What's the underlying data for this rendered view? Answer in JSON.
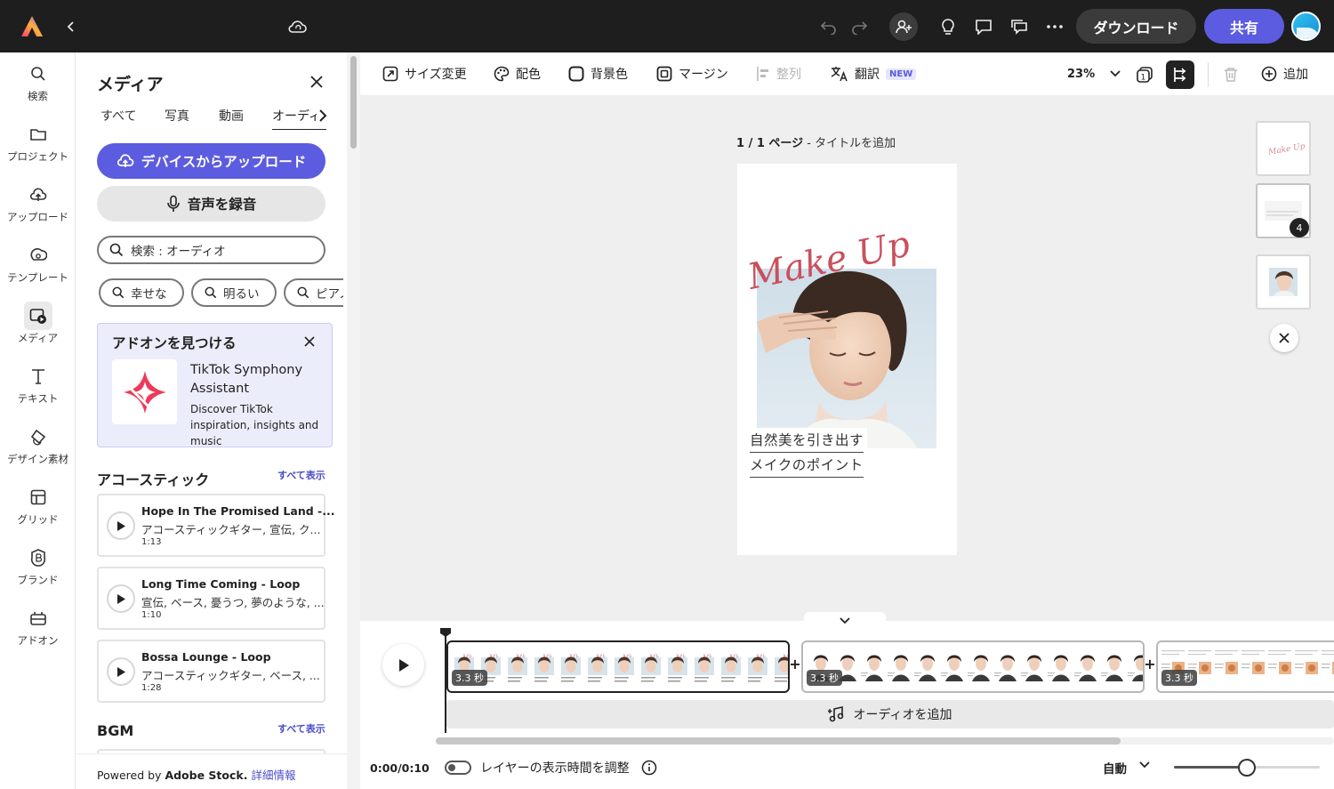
{
  "topbar": {
    "download_label": "ダウンロード",
    "share_label": "共有"
  },
  "leftnav": [
    {
      "label": "検索",
      "icon": "search-icon"
    },
    {
      "label": "プロジェクト",
      "icon": "folder-icon"
    },
    {
      "label": "アップロード",
      "icon": "upload-cloud-icon"
    },
    {
      "label": "テンプレート",
      "icon": "template-icon"
    },
    {
      "label": "メディア",
      "icon": "media-icon",
      "active": true
    },
    {
      "label": "テキスト",
      "icon": "text-icon"
    },
    {
      "label": "デザイン素材",
      "icon": "shapes-icon"
    },
    {
      "label": "グリッド",
      "icon": "grid-icon"
    },
    {
      "label": "ブランド",
      "icon": "brand-icon"
    },
    {
      "label": "アドオン",
      "icon": "addon-icon"
    }
  ],
  "panel": {
    "title": "メディア",
    "tabs": [
      "すべて",
      "写真",
      "動画",
      "オーディオ"
    ],
    "active_tab": "オーディオ",
    "upload_label": "デバイスからアップロード",
    "record_label": "音声を録音",
    "search_value": "検索 : オーディオ",
    "chips": [
      "幸せな",
      "明るい",
      "ピアノ"
    ],
    "addon": {
      "heading": "アドオンを見つける",
      "name": "TikTok Symphony Assistant",
      "desc": "Discover TikTok inspiration, insights and music"
    },
    "section_acoustic": "アコースティック",
    "section_bgm": "BGM",
    "see_all": "すべて表示",
    "tracks": [
      {
        "title": "Hope In The Promised Land -...",
        "tags": "アコースティックギター, 宣伝, ク...",
        "duration": "1:13"
      },
      {
        "title": "Long Time Coming - Loop",
        "tags": "宣伝, ベース, 憂うつ, 夢のような, ...",
        "duration": "1:10"
      },
      {
        "title": "Bossa Lounge - Loop",
        "tags": "アコースティックギター, ベース, ...",
        "duration": "1:28"
      }
    ],
    "powered_prefix": "Powered by ",
    "powered_brand": "Adobe Stock.",
    "powered_link": " 詳細情報"
  },
  "toolbar": {
    "resize": "サイズ変更",
    "color": "配色",
    "background": "背景色",
    "margin": "マージン",
    "align": "整列",
    "translate": "翻訳",
    "new_badge": "NEW",
    "zoom": "23%",
    "add": "追加"
  },
  "canvas": {
    "page_count": "1 / 1 ページ",
    "page_title": " - タイトルを追加",
    "artboard_script": "Make Up",
    "caption_line1": "自然美を引き出す",
    "caption_line2": "メイクのポイント",
    "thumb_badge": "4"
  },
  "timeline": {
    "clips": [
      {
        "duration": "3.3 秒"
      },
      {
        "duration": "3.3 秒"
      },
      {
        "duration": "3.3 秒"
      }
    ],
    "add_audio": "オーディオを追加",
    "time": "0:00/0:10",
    "layer_toggle": "レイヤーの表示時間を調整",
    "speed": "自動",
    "zoom_level": 0.5
  },
  "colors": {
    "accent": "#5c5ce0",
    "topbar": "#1e1e1e",
    "script": "#c9505c"
  }
}
